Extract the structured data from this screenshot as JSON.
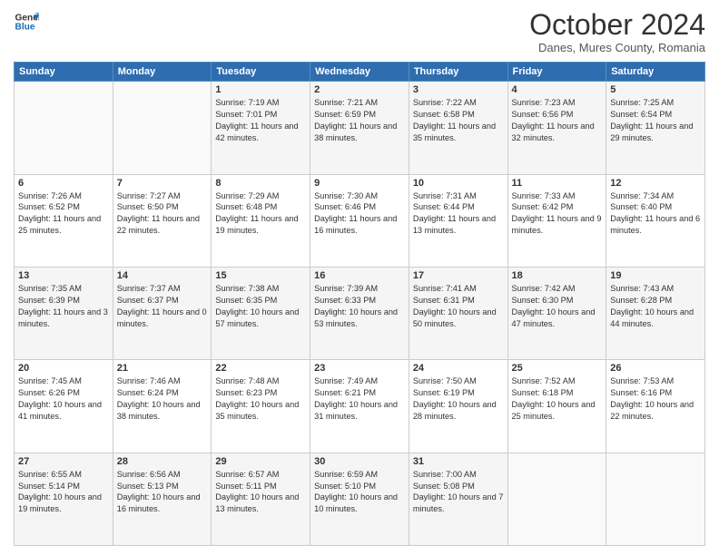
{
  "header": {
    "logo_line1": "General",
    "logo_line2": "Blue",
    "title": "October 2024",
    "subtitle": "Danes, Mures County, Romania"
  },
  "days_of_week": [
    "Sunday",
    "Monday",
    "Tuesday",
    "Wednesday",
    "Thursday",
    "Friday",
    "Saturday"
  ],
  "weeks": [
    [
      {
        "day": "",
        "text": ""
      },
      {
        "day": "",
        "text": ""
      },
      {
        "day": "1",
        "text": "Sunrise: 7:19 AM\nSunset: 7:01 PM\nDaylight: 11 hours and 42 minutes."
      },
      {
        "day": "2",
        "text": "Sunrise: 7:21 AM\nSunset: 6:59 PM\nDaylight: 11 hours and 38 minutes."
      },
      {
        "day": "3",
        "text": "Sunrise: 7:22 AM\nSunset: 6:58 PM\nDaylight: 11 hours and 35 minutes."
      },
      {
        "day": "4",
        "text": "Sunrise: 7:23 AM\nSunset: 6:56 PM\nDaylight: 11 hours and 32 minutes."
      },
      {
        "day": "5",
        "text": "Sunrise: 7:25 AM\nSunset: 6:54 PM\nDaylight: 11 hours and 29 minutes."
      }
    ],
    [
      {
        "day": "6",
        "text": "Sunrise: 7:26 AM\nSunset: 6:52 PM\nDaylight: 11 hours and 25 minutes."
      },
      {
        "day": "7",
        "text": "Sunrise: 7:27 AM\nSunset: 6:50 PM\nDaylight: 11 hours and 22 minutes."
      },
      {
        "day": "8",
        "text": "Sunrise: 7:29 AM\nSunset: 6:48 PM\nDaylight: 11 hours and 19 minutes."
      },
      {
        "day": "9",
        "text": "Sunrise: 7:30 AM\nSunset: 6:46 PM\nDaylight: 11 hours and 16 minutes."
      },
      {
        "day": "10",
        "text": "Sunrise: 7:31 AM\nSunset: 6:44 PM\nDaylight: 11 hours and 13 minutes."
      },
      {
        "day": "11",
        "text": "Sunrise: 7:33 AM\nSunset: 6:42 PM\nDaylight: 11 hours and 9 minutes."
      },
      {
        "day": "12",
        "text": "Sunrise: 7:34 AM\nSunset: 6:40 PM\nDaylight: 11 hours and 6 minutes."
      }
    ],
    [
      {
        "day": "13",
        "text": "Sunrise: 7:35 AM\nSunset: 6:39 PM\nDaylight: 11 hours and 3 minutes."
      },
      {
        "day": "14",
        "text": "Sunrise: 7:37 AM\nSunset: 6:37 PM\nDaylight: 11 hours and 0 minutes."
      },
      {
        "day": "15",
        "text": "Sunrise: 7:38 AM\nSunset: 6:35 PM\nDaylight: 10 hours and 57 minutes."
      },
      {
        "day": "16",
        "text": "Sunrise: 7:39 AM\nSunset: 6:33 PM\nDaylight: 10 hours and 53 minutes."
      },
      {
        "day": "17",
        "text": "Sunrise: 7:41 AM\nSunset: 6:31 PM\nDaylight: 10 hours and 50 minutes."
      },
      {
        "day": "18",
        "text": "Sunrise: 7:42 AM\nSunset: 6:30 PM\nDaylight: 10 hours and 47 minutes."
      },
      {
        "day": "19",
        "text": "Sunrise: 7:43 AM\nSunset: 6:28 PM\nDaylight: 10 hours and 44 minutes."
      }
    ],
    [
      {
        "day": "20",
        "text": "Sunrise: 7:45 AM\nSunset: 6:26 PM\nDaylight: 10 hours and 41 minutes."
      },
      {
        "day": "21",
        "text": "Sunrise: 7:46 AM\nSunset: 6:24 PM\nDaylight: 10 hours and 38 minutes."
      },
      {
        "day": "22",
        "text": "Sunrise: 7:48 AM\nSunset: 6:23 PM\nDaylight: 10 hours and 35 minutes."
      },
      {
        "day": "23",
        "text": "Sunrise: 7:49 AM\nSunset: 6:21 PM\nDaylight: 10 hours and 31 minutes."
      },
      {
        "day": "24",
        "text": "Sunrise: 7:50 AM\nSunset: 6:19 PM\nDaylight: 10 hours and 28 minutes."
      },
      {
        "day": "25",
        "text": "Sunrise: 7:52 AM\nSunset: 6:18 PM\nDaylight: 10 hours and 25 minutes."
      },
      {
        "day": "26",
        "text": "Sunrise: 7:53 AM\nSunset: 6:16 PM\nDaylight: 10 hours and 22 minutes."
      }
    ],
    [
      {
        "day": "27",
        "text": "Sunrise: 6:55 AM\nSunset: 5:14 PM\nDaylight: 10 hours and 19 minutes."
      },
      {
        "day": "28",
        "text": "Sunrise: 6:56 AM\nSunset: 5:13 PM\nDaylight: 10 hours and 16 minutes."
      },
      {
        "day": "29",
        "text": "Sunrise: 6:57 AM\nSunset: 5:11 PM\nDaylight: 10 hours and 13 minutes."
      },
      {
        "day": "30",
        "text": "Sunrise: 6:59 AM\nSunset: 5:10 PM\nDaylight: 10 hours and 10 minutes."
      },
      {
        "day": "31",
        "text": "Sunrise: 7:00 AM\nSunset: 5:08 PM\nDaylight: 10 hours and 7 minutes."
      },
      {
        "day": "",
        "text": ""
      },
      {
        "day": "",
        "text": ""
      }
    ]
  ]
}
